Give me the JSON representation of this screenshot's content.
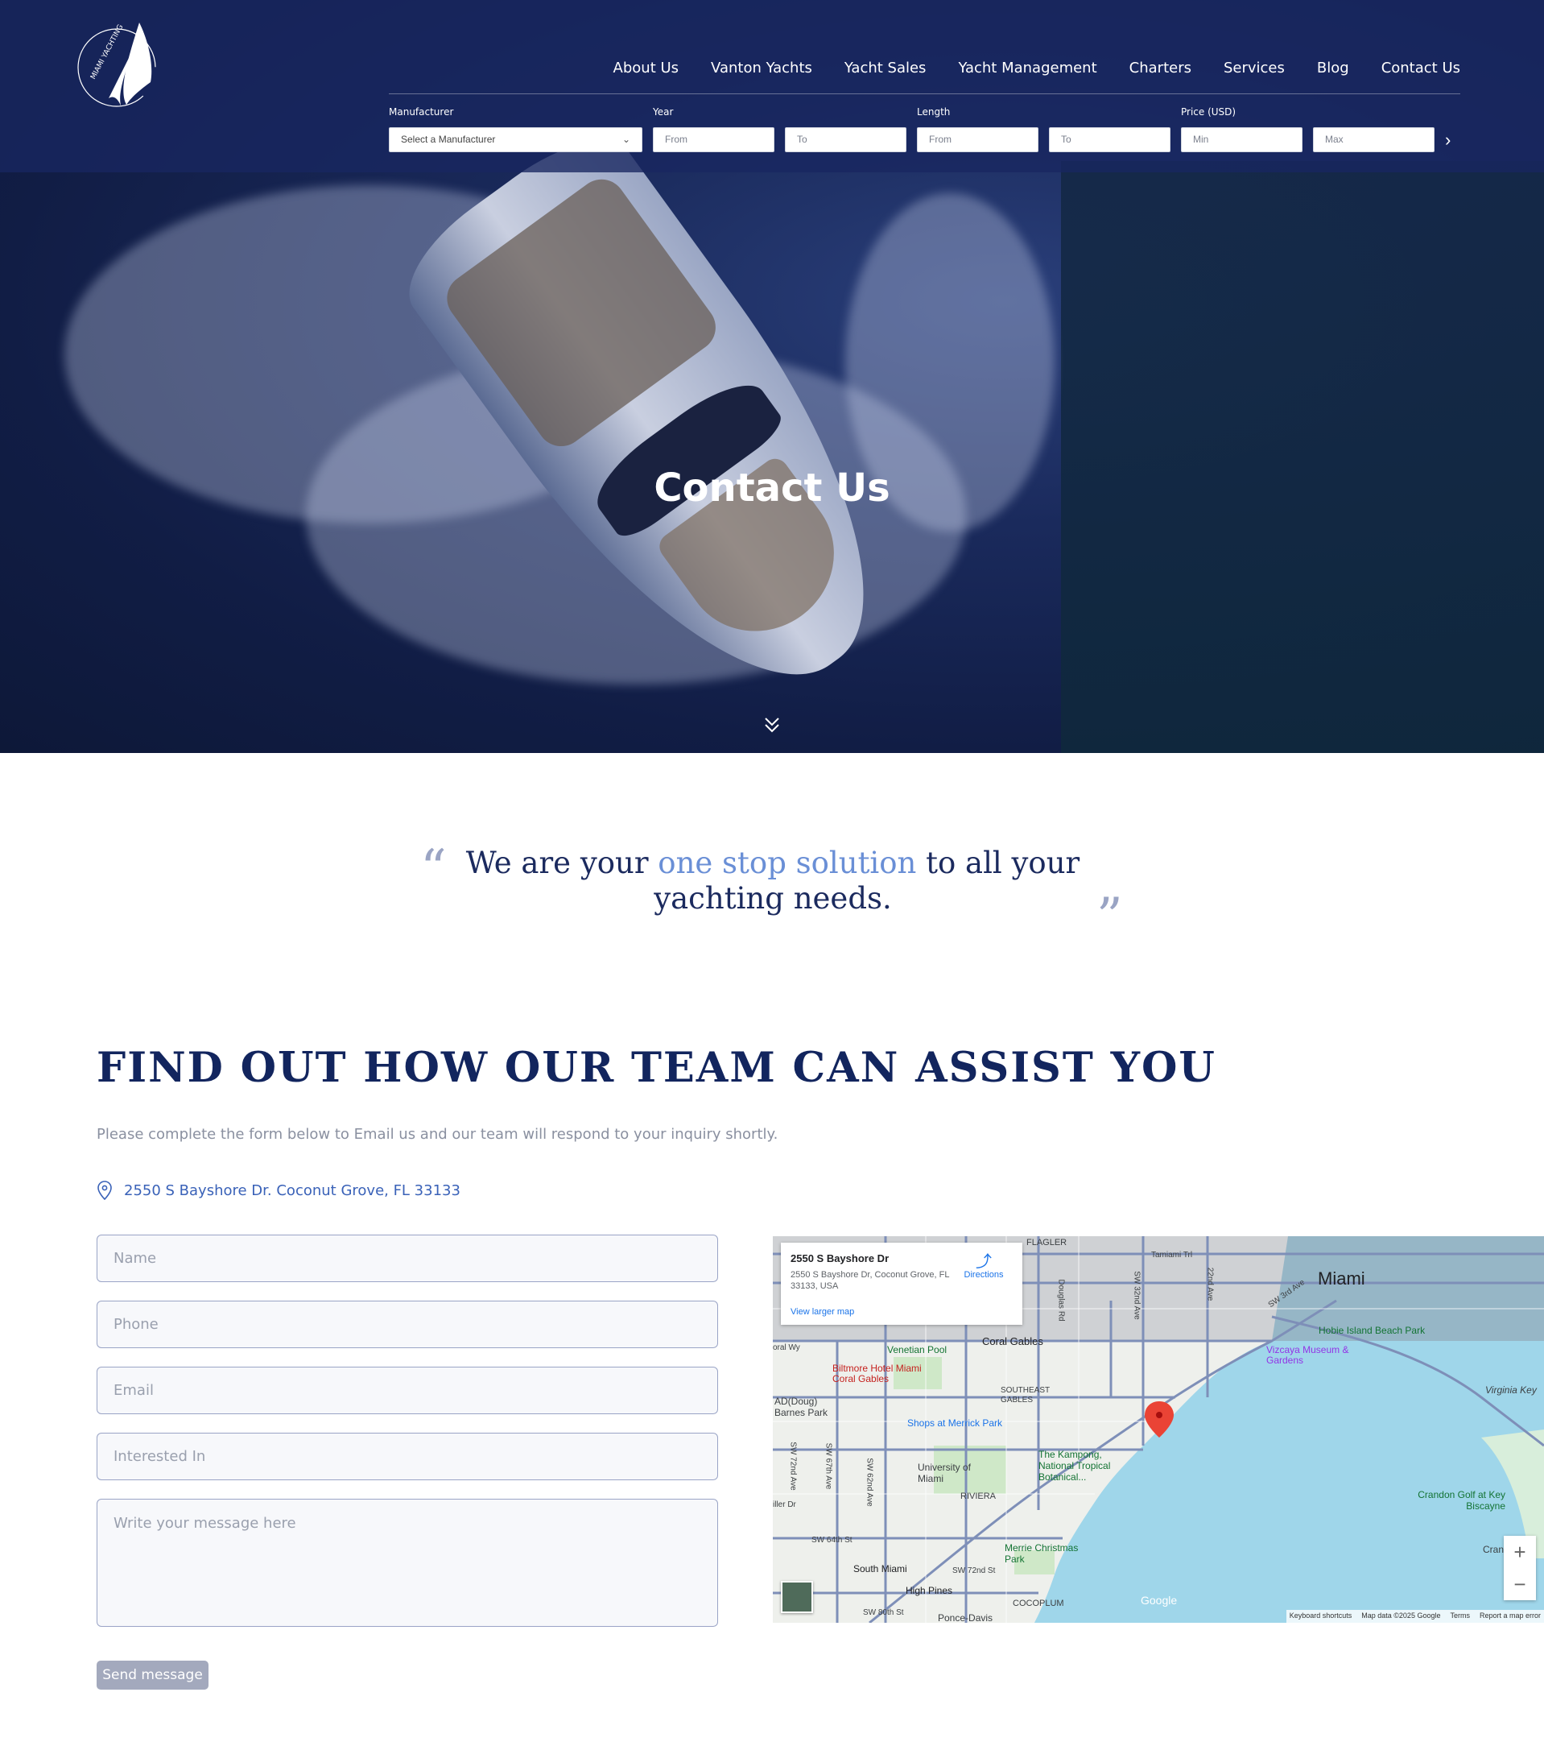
{
  "nav": {
    "items": [
      "About Us",
      "Vanton Yachts",
      "Yacht Sales",
      "Yacht Management",
      "Charters",
      "Services",
      "Blog",
      "Contact Us"
    ]
  },
  "logo": {
    "text": "MIAMI YACHTING"
  },
  "search": {
    "manufacturer_label": "Manufacturer",
    "manufacturer_value": "Select a Manufacturer",
    "year_label": "Year",
    "year_from": "From",
    "year_to": "To",
    "length_label": "Length",
    "length_from": "From",
    "length_to": "To",
    "price_label": "Price (USD)",
    "price_min": "Min",
    "price_max": "Max"
  },
  "hero": {
    "title": "Contact Us"
  },
  "quote": {
    "before": "We are your ",
    "accent": "one stop solution",
    "after": " to all your yachting needs."
  },
  "contact": {
    "heading": "FIND OUT HOW OUR TEAM CAN ASSIST YOU",
    "subtitle": "Please complete the form below to Email us and our team will respond to your inquiry shortly.",
    "address": "2550 S Bayshore Dr. Coconut Grove, FL 33133"
  },
  "form": {
    "name_placeholder": "Name",
    "phone_placeholder": "Phone",
    "email_placeholder": "Email",
    "interest_placeholder": "Interested In",
    "message_placeholder": "Write your message here",
    "send_label": "Send message"
  },
  "map": {
    "card_title": "2550 S Bayshore Dr",
    "card_address": "2550 S Bayshore Dr, Coconut Grove, FL 33133, USA",
    "directions": "Directions",
    "larger_map": "View larger map",
    "labels": {
      "miami": "Miami",
      "flagler": "FLAGLER",
      "coral_gables": "Coral Gables",
      "venetian_pool": "Venetian Pool",
      "biltmore": "Biltmore Hotel Miami Coral Gables",
      "southeast_gables": "SOUTHEAST GABLES",
      "doug_barnes": "AD(Doug) Barnes Park",
      "shops": "Shops at Merrick Park",
      "vizcaya": "Vizcaya Museum & Gardens",
      "hobie": "Hobie Island Beach Park",
      "virginia": "Virginia Key",
      "kampong": "The Kampong, National Tropical Botanical...",
      "um": "University of Miami",
      "riviera": "RIVIERA",
      "merrie": "Merrie Christmas Park",
      "crandon": "Crandon Golf at Key Biscayne",
      "south_miami": "South Miami",
      "high_pines": "High Pines",
      "coco": "COCOPLUM",
      "ponce": "Ponce-Davis",
      "sw64": "SW 64th St",
      "sw72": "SW 72nd St",
      "sw80": "SW 80th St",
      "tamiami": "Tamiami Trl",
      "douglas": "Douglas Rd",
      "sw32": "SW 32nd Ave",
      "ave22": "22nd Ave",
      "sw3": "SW 3rd Ave",
      "sw72ave": "SW 72nd Ave",
      "sw67": "SW 67th Ave",
      "sw62": "SW 62nd Ave",
      "miller": "iller Dr",
      "oralwy": "oral Wy",
      "cran": "Cran"
    },
    "google": "Google",
    "attrib_keys": "Keyboard shortcuts",
    "attrib_data": "Map data ©2025 Google",
    "attrib_terms": "Terms",
    "attrib_report": "Report a map error",
    "zoom_in": "+",
    "zoom_out": "−"
  },
  "colors": {
    "navy": "#12255e",
    "accent": "#6a8fd6",
    "link": "#3a62b8",
    "button": "#a3a9bd"
  }
}
